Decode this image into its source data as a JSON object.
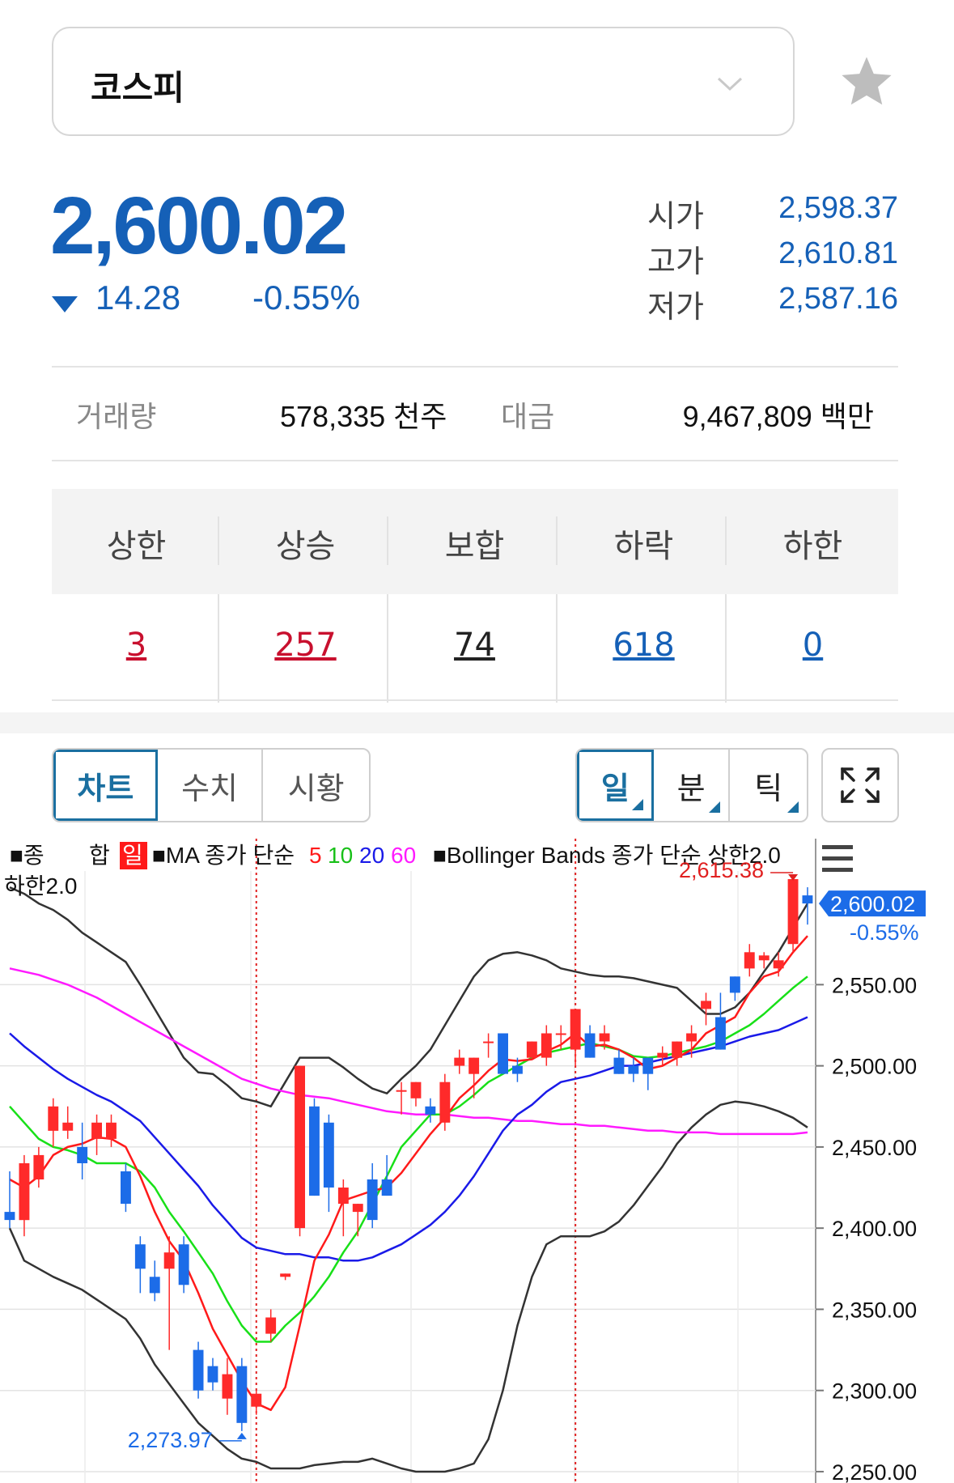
{
  "index": {
    "name": "코스피"
  },
  "quote": {
    "price": "2,600.02",
    "change": "14.28",
    "change_pct": "-0.55%",
    "open_label": "시가",
    "open": "2,598.37",
    "high_label": "고가",
    "high": "2,610.81",
    "low_label": "저가",
    "low": "2,587.16"
  },
  "volume": {
    "volume_label": "거래량",
    "volume_value": "578,335 천주",
    "amount_label": "대금",
    "amount_value": "9,467,809 백만"
  },
  "breadth": {
    "headers": [
      "상한",
      "상승",
      "보합",
      "하락",
      "하한"
    ],
    "values": [
      "3",
      "257",
      "74",
      "618",
      "0"
    ],
    "colors": [
      "#c8102e",
      "#c8102e",
      "#222222",
      "#1560b7",
      "#1560b7"
    ]
  },
  "tabs": {
    "view": [
      "차트",
      "수치",
      "시황"
    ],
    "period": [
      "일",
      "분",
      "틱"
    ]
  },
  "chart_data": {
    "type": "candlestick",
    "legend_line1": "■종   합 일 ■MA 종가 단순 5 10 20 60  ■Bollinger Bands 종가 단순 상한2.0",
    "legend_line2": "하한2.0",
    "legend_parts": {
      "square1": "■종",
      "hap": "합",
      "day": "일",
      "ma": "■MA 종가 단순",
      "ma5": "5",
      "ma10": "10",
      "ma20": "20",
      "ma60": "60",
      "bb": "■Bollinger Bands 종가 단순 상한2.0",
      "bb_low": "하한2.0"
    },
    "y_ticks": [
      "2,550.00",
      "2,500.00",
      "2,450.00",
      "2,400.00",
      "2,350.00",
      "2,300.00",
      "2,250.00"
    ],
    "y_tick_values": [
      2550,
      2500,
      2450,
      2400,
      2350,
      2300,
      2250
    ],
    "ylim": [
      2243,
      2620
    ],
    "current_price_label": "2,600.02",
    "current_change_label": "-0.55%",
    "max_label": "2,615.38",
    "min_label": "2,273.97",
    "colors": {
      "up": "#ff2a2a",
      "down": "#1c6ce8",
      "ma5": "#ff1a1a",
      "ma10": "#18e018",
      "ma20": "#1a1ae8",
      "ma60": "#ff1aff",
      "bb": "#333333"
    },
    "candles": [
      [
        2410,
        2435,
        2400,
        2405
      ],
      [
        2405,
        2445,
        2395,
        2440
      ],
      [
        2430,
        2450,
        2425,
        2445
      ],
      [
        2460,
        2480,
        2450,
        2475
      ],
      [
        2460,
        2475,
        2455,
        2465
      ],
      [
        2450,
        2465,
        2430,
        2440
      ],
      [
        2455,
        2470,
        2445,
        2465
      ],
      [
        2455,
        2470,
        2450,
        2465
      ],
      [
        2435,
        2440,
        2410,
        2415
      ],
      [
        2390,
        2395,
        2360,
        2375
      ],
      [
        2370,
        2380,
        2355,
        2360
      ],
      [
        2375,
        2395,
        2325,
        2385
      ],
      [
        2390,
        2395,
        2360,
        2365
      ],
      [
        2325,
        2330,
        2295,
        2300
      ],
      [
        2315,
        2320,
        2300,
        2305
      ],
      [
        2295,
        2320,
        2285,
        2310
      ],
      [
        2315,
        2320,
        2275,
        2280
      ],
      [
        2290,
        2300,
        2285,
        2298
      ],
      [
        2335,
        2350,
        2330,
        2345
      ],
      [
        2370,
        2372,
        2368,
        2372
      ],
      [
        2400,
        2500,
        2395,
        2500
      ],
      [
        2475,
        2480,
        2420,
        2420
      ],
      [
        2465,
        2470,
        2410,
        2425
      ],
      [
        2415,
        2430,
        2395,
        2425
      ],
      [
        2410,
        2415,
        2395,
        2415
      ],
      [
        2430,
        2440,
        2400,
        2405
      ],
      [
        2430,
        2445,
        2420,
        2420
      ],
      [
        2485,
        2490,
        2470,
        2485
      ],
      [
        2480,
        2490,
        2475,
        2490
      ],
      [
        2475,
        2480,
        2465,
        2470
      ],
      [
        2465,
        2495,
        2460,
        2490
      ],
      [
        2500,
        2510,
        2495,
        2505
      ],
      [
        2495,
        2505,
        2480,
        2505
      ],
      [
        2515,
        2520,
        2505,
        2515
      ],
      [
        2520,
        2520,
        2495,
        2495
      ],
      [
        2500,
        2505,
        2490,
        2495
      ],
      [
        2505,
        2515,
        2505,
        2515
      ],
      [
        2505,
        2525,
        2500,
        2520
      ],
      [
        2520,
        2525,
        2510,
        2520
      ],
      [
        2510,
        2535,
        2500,
        2535
      ],
      [
        2520,
        2525,
        2505,
        2505
      ],
      [
        2515,
        2525,
        2510,
        2520
      ],
      [
        2505,
        2510,
        2495,
        2495
      ],
      [
        2500,
        2505,
        2490,
        2495
      ],
      [
        2505,
        2505,
        2485,
        2495
      ],
      [
        2505,
        2512,
        2500,
        2508
      ],
      [
        2505,
        2515,
        2500,
        2515
      ],
      [
        2515,
        2525,
        2505,
        2520
      ],
      [
        2535,
        2545,
        2525,
        2540
      ],
      [
        2530,
        2545,
        2510,
        2510
      ],
      [
        2555,
        2555,
        2540,
        2545
      ],
      [
        2560,
        2575,
        2555,
        2570
      ],
      [
        2565,
        2570,
        2560,
        2568
      ],
      [
        2560,
        2570,
        2555,
        2565
      ],
      [
        2575,
        2615,
        2570,
        2615
      ],
      [
        2605,
        2610,
        2587,
        2600
      ]
    ],
    "ma5": [
      2430,
      2425,
      2432,
      2445,
      2450,
      2452,
      2456,
      2455,
      2450,
      2432,
      2410,
      2392,
      2380,
      2360,
      2338,
      2322,
      2306,
      2292,
      2288,
      2302,
      2340,
      2380,
      2396,
      2417,
      2420,
      2423,
      2425,
      2434,
      2446,
      2458,
      2468,
      2480,
      2488,
      2497,
      2504,
      2503,
      2504,
      2509,
      2513,
      2520,
      2512,
      2513,
      2510,
      2505,
      2498,
      2500,
      2505,
      2510,
      2520,
      2525,
      2530,
      2545,
      2555,
      2558,
      2570,
      2580
    ],
    "ma10": [
      2475,
      2465,
      2455,
      2450,
      2448,
      2445,
      2440,
      2440,
      2440,
      2435,
      2425,
      2410,
      2398,
      2385,
      2372,
      2355,
      2340,
      2330,
      2330,
      2340,
      2348,
      2358,
      2370,
      2385,
      2398,
      2415,
      2432,
      2450,
      2460,
      2470,
      2470,
      2475,
      2482,
      2490,
      2495,
      2500,
      2505,
      2508,
      2510,
      2512,
      2514,
      2512,
      2510,
      2506,
      2505,
      2506,
      2508,
      2510,
      2512,
      2515,
      2520,
      2525,
      2532,
      2540,
      2548,
      2555
    ],
    "ma20": [
      2520,
      2512,
      2505,
      2498,
      2492,
      2487,
      2482,
      2478,
      2472,
      2466,
      2456,
      2446,
      2436,
      2426,
      2414,
      2404,
      2394,
      2388,
      2386,
      2384,
      2384,
      2382,
      2382,
      2380,
      2380,
      2382,
      2386,
      2390,
      2396,
      2402,
      2410,
      2420,
      2432,
      2446,
      2460,
      2470,
      2476,
      2484,
      2490,
      2492,
      2494,
      2497,
      2500,
      2500,
      2502,
      2504,
      2506,
      2508,
      2510,
      2512,
      2515,
      2518,
      2520,
      2522,
      2526,
      2530
    ],
    "ma60": [
      2560,
      2558,
      2556,
      2553,
      2550,
      2546,
      2542,
      2537,
      2532,
      2527,
      2522,
      2517,
      2512,
      2507,
      2502,
      2497,
      2492,
      2489,
      2486,
      2484,
      2482,
      2481,
      2480,
      2478,
      2476,
      2474,
      2472,
      2471,
      2470,
      2470,
      2470,
      2469,
      2468,
      2468,
      2467,
      2466,
      2466,
      2465,
      2464,
      2464,
      2463,
      2463,
      2462,
      2461,
      2460,
      2460,
      2459,
      2459,
      2459,
      2458,
      2458,
      2458,
      2458,
      2458,
      2458,
      2459
    ],
    "bb_upper": [
      2610,
      2606,
      2600,
      2596,
      2590,
      2582,
      2576,
      2570,
      2564,
      2550,
      2535,
      2520,
      2505,
      2496,
      2495,
      2488,
      2480,
      2478,
      2475,
      2490,
      2505,
      2505,
      2505,
      2499,
      2492,
      2486,
      2483,
      2492,
      2500,
      2510,
      2525,
      2540,
      2555,
      2565,
      2569,
      2570,
      2568,
      2565,
      2560,
      2558,
      2556,
      2555,
      2555,
      2554,
      2552,
      2550,
      2548,
      2540,
      2532,
      2532,
      2536,
      2545,
      2558,
      2570,
      2585,
      2600
    ],
    "bb_lower": [
      2400,
      2380,
      2375,
      2370,
      2366,
      2362,
      2356,
      2350,
      2344,
      2332,
      2316,
      2304,
      2292,
      2280,
      2272,
      2264,
      2258,
      2256,
      2252,
      2252,
      2252,
      2254,
      2255,
      2256,
      2256,
      2258,
      2255,
      2252,
      2250,
      2250,
      2250,
      2252,
      2255,
      2270,
      2300,
      2340,
      2370,
      2390,
      2395,
      2395,
      2395,
      2398,
      2404,
      2414,
      2426,
      2438,
      2452,
      2462,
      2470,
      2476,
      2478,
      2477,
      2475,
      2472,
      2468,
      2462
    ],
    "vlines_at_candle": [
      17,
      39
    ]
  }
}
